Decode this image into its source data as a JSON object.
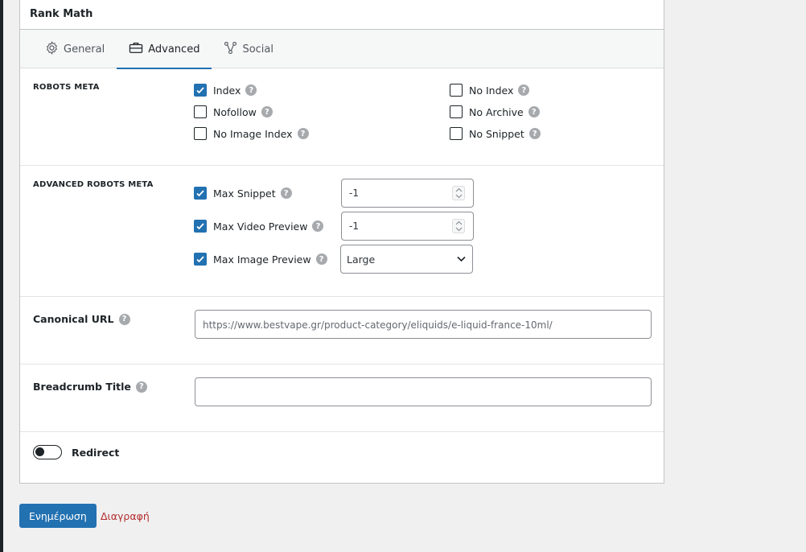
{
  "panel": {
    "title": "Rank Math"
  },
  "tabs": [
    {
      "label": "General",
      "icon": "gear-icon"
    },
    {
      "label": "Advanced",
      "icon": "toolbox-icon",
      "active": true
    },
    {
      "label": "Social",
      "icon": "share-nodes-icon"
    }
  ],
  "robots_meta": {
    "label": "ROBOTS META",
    "left": [
      {
        "label": "Index",
        "checked": true
      },
      {
        "label": "Nofollow",
        "checked": false
      },
      {
        "label": "No Image Index",
        "checked": false
      }
    ],
    "right": [
      {
        "label": "No Index",
        "checked": false
      },
      {
        "label": "No Archive",
        "checked": false
      },
      {
        "label": "No Snippet",
        "checked": false
      }
    ]
  },
  "advanced_robots": {
    "label": "ADVANCED ROBOTS META",
    "max_snippet": {
      "label": "Max Snippet",
      "checked": true,
      "value": "-1"
    },
    "max_video": {
      "label": "Max Video Preview",
      "checked": true,
      "value": "-1"
    },
    "max_image": {
      "label": "Max Image Preview",
      "checked": true,
      "value": "Large"
    }
  },
  "canonical": {
    "label": "Canonical URL",
    "placeholder": "https://www.bestvape.gr/product-category/eliquids/e-liquid-france-10ml/"
  },
  "breadcrumb": {
    "label": "Breadcrumb Title",
    "value": ""
  },
  "redirect": {
    "label": "Redirect",
    "enabled": false
  },
  "actions": {
    "update_label": "Ενημέρωση",
    "delete_label": "Διαγραφή"
  },
  "colors": {
    "accent": "#2271b1",
    "danger": "#b32d2e",
    "help": "#a7aaad"
  }
}
